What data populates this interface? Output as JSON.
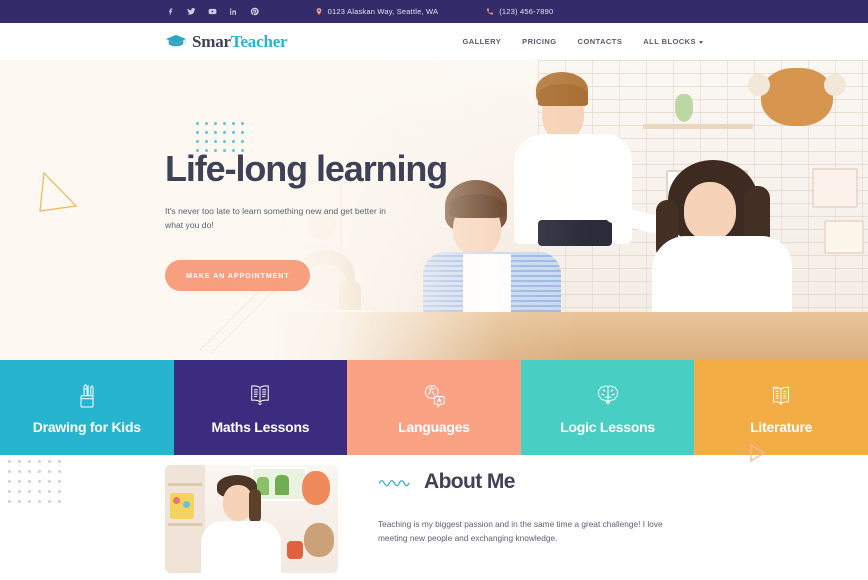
{
  "topbar": {
    "social": [
      {
        "name": "facebook-icon",
        "label": "Facebook"
      },
      {
        "name": "twitter-icon",
        "label": "Twitter"
      },
      {
        "name": "youtube-icon",
        "label": "YouTube"
      },
      {
        "name": "linkedin-icon",
        "label": "LinkedIn"
      },
      {
        "name": "pinterest-icon",
        "label": "Pinterest"
      }
    ],
    "address": "0123 Alaskan Way, Seattle, WA",
    "phone": "(123) 456-7890"
  },
  "header": {
    "logo_part1": "Smar",
    "logo_part2": "Teacher",
    "nav": [
      {
        "label": "GALLERY"
      },
      {
        "label": "PRICING"
      },
      {
        "label": "CONTACTS"
      },
      {
        "label": "ALL BLOCKS",
        "has_caret": true
      }
    ]
  },
  "hero": {
    "title": "Life-long learning",
    "subtitle": "It's never too late to learn something new and get better in what you do!",
    "button": "MAKE AN APPOINTMENT"
  },
  "tiles": [
    {
      "label": "Drawing for Kids",
      "color": "#26b4ce",
      "icon": "pencil-cup-icon"
    },
    {
      "label": "Maths Lessons",
      "color": "#3b2c7f",
      "icon": "math-book-icon"
    },
    {
      "label": "Languages",
      "color": "#fca284",
      "icon": "translate-icon"
    },
    {
      "label": "Logic Lessons",
      "color": "#49cec4",
      "icon": "brain-icon"
    },
    {
      "label": "Literature",
      "color": "#f3ad45",
      "icon": "open-book-icon"
    }
  ],
  "about": {
    "title": "About Me",
    "text": "Teaching is my biggest passion and in the same time a great challenge! I love meeting new people and exchanging knowledge."
  },
  "colors": {
    "navy": "#342b6b",
    "teal": "#26b4ce",
    "coral": "#f79f7e",
    "amber": "#f3ad45",
    "cream": "#fdf8f2",
    "text_dark": "#3f4256"
  }
}
